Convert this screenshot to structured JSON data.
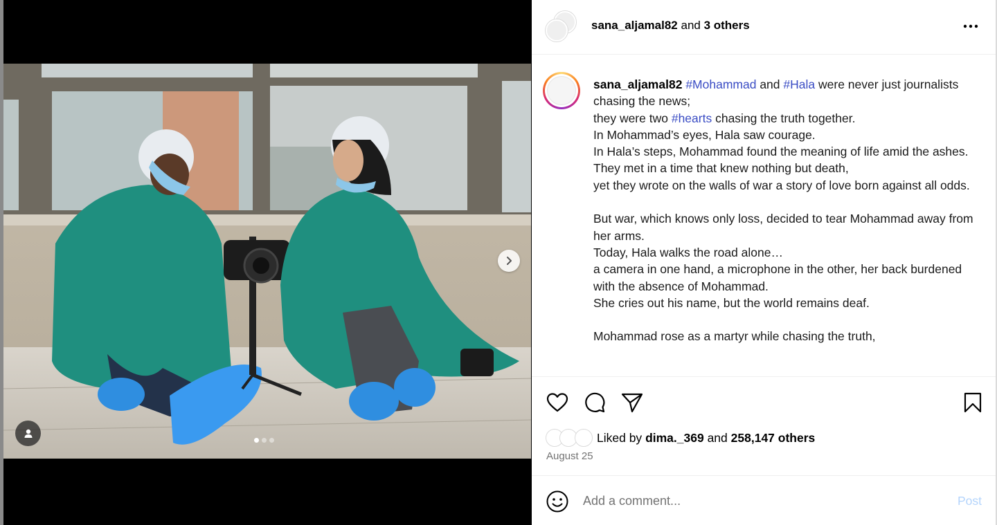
{
  "post_header": {
    "username": "sana_aljamal82",
    "connector": " and ",
    "others": "3 others",
    "more_icon": "more-horizontal-icon"
  },
  "media": {
    "next_icon": "chevron-right-icon",
    "tag_icon": "user-tag-icon",
    "carousel": {
      "count": 3,
      "active_index": 1
    }
  },
  "caption": {
    "username": "sana_aljamal82",
    "hashtag_1": "#Mohammad",
    "and_word": "and",
    "hashtag_2": "#Hala",
    "l1_rest": "were never just journalists chasing the news;",
    "l2_start": "they were two",
    "hashtag_3": "#hearts",
    "l2_rest": "chasing the truth together.",
    "l3": "In Mohammad’s eyes, Hala saw courage.",
    "l4": "In Hala’s steps, Mohammad found the meaning of life amid the ashes.",
    "l5": "They met in a time that knew nothing but death,",
    "l6": "yet they wrote on the walls of war a story of love born against all odds.",
    "l7": "But war, which knows only loss, decided to tear Mohammad away from her arms.",
    "l8": "Today, Hala walks the road alone…",
    "l9": "a camera in one hand, a microphone in the other, her back burdened with the absence of Mohammad.",
    "l10": "She cries out his name, but the world remains deaf.",
    "l11": "Mohammad rose as a martyr while chasing the truth,"
  },
  "actions": {
    "like_icon": "heart-icon",
    "comment_icon": "comment-icon",
    "share_icon": "share-icon",
    "save_icon": "bookmark-icon"
  },
  "likes": {
    "prefix": "Liked by",
    "user": "dima._369",
    "connector": "and",
    "count": "258,147 others"
  },
  "date": "August 25",
  "comment": {
    "emoji_icon": "emoji-icon",
    "placeholder": "Add a comment...",
    "post_label": "Post"
  },
  "colors": {
    "hashtag": "#3a4cc4",
    "post_button_disabled": "#b3d4fc",
    "muted_text": "#737373"
  }
}
